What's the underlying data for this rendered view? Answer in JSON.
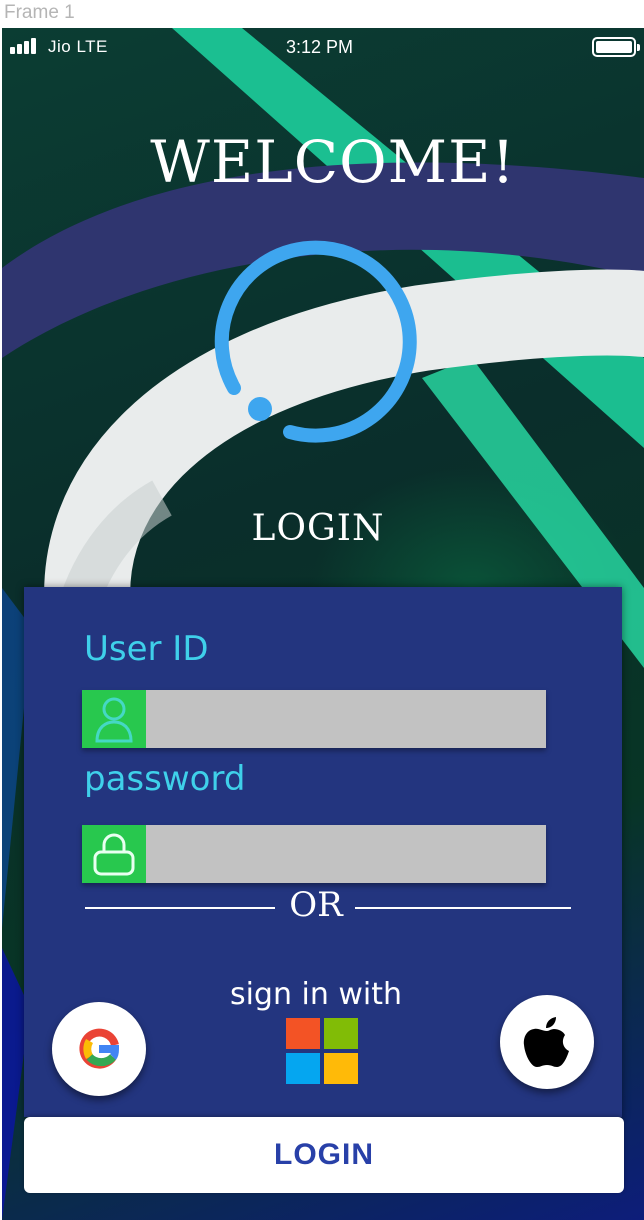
{
  "frame": {
    "label": "Frame 1"
  },
  "status_bar": {
    "carrier": "Jio  LTE",
    "time": "3:12 PM",
    "signal_icon": "signal-bars-icon",
    "battery_icon": "battery-full-icon"
  },
  "header": {
    "welcome": "WELCOME!",
    "logo_icon": "circle-logo-icon",
    "login_title": "LOGIN"
  },
  "form": {
    "user_id_label": "User ID",
    "user_id_value": "",
    "user_icon": "user-icon",
    "password_label": "password",
    "password_value": "",
    "lock_icon": "lock-icon",
    "or_text": "OR",
    "sign_in_with": "sign in with"
  },
  "social": [
    {
      "name": "google",
      "icon": "google-icon"
    },
    {
      "name": "microsoft",
      "icon": "microsoft-icon"
    },
    {
      "name": "apple",
      "icon": "apple-icon"
    }
  ],
  "footer": {
    "login_button": "LOGIN"
  },
  "colors": {
    "panel": "#23357f",
    "label": "#3fd0ea",
    "icon_box": "#28c84e",
    "input": "#c2c2c2",
    "logo_ring": "#3ea6ef",
    "button_text": "#2840a8"
  }
}
